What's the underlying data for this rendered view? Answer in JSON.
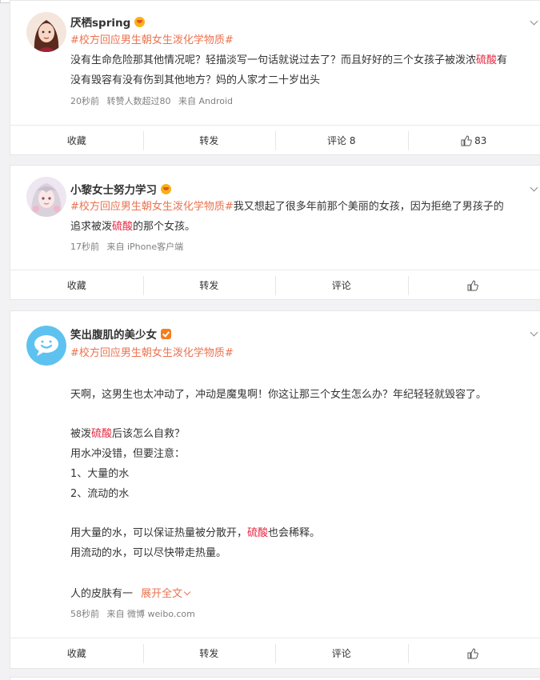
{
  "posts": [
    {
      "user": "厌栖spring",
      "badge": "crown",
      "topic": "#校方回应男生朝女生泼化学物质#",
      "line1_a": "没有生命危险那其他情况呢？轻描淡写一句话就说过去了？而且好好的三个女孩子被泼浓",
      "line1_kw": "硫酸",
      "line1_b": "有",
      "line2": "没有毁容有没有伤到其他地方？妈的人家才二十岁出头",
      "meta": {
        "time": "20秒前",
        "extra": "转赞人数超过80",
        "source": "来自 Android"
      },
      "actions": {
        "fav": "收藏",
        "repost": "转发",
        "comment": "评论 8",
        "like": "83"
      }
    },
    {
      "user": "小黎女士努力学习",
      "badge": "crown",
      "topic": "#校方回应男生朝女生泼化学物质#",
      "line1_rest": "我又想起了很多年前那个美丽的女孩，因为拒绝了男孩子的",
      "line2_a": "追求被泼",
      "line2_kw": "硫酸",
      "line2_b": "的那个女孩。",
      "meta": {
        "time": "17秒前",
        "source": "来自 iPhone客户端"
      },
      "actions": {
        "fav": "收藏",
        "repost": "转发",
        "comment": "评论",
        "like": ""
      }
    },
    {
      "user": "笑出腹肌的美少女",
      "badge": "verified",
      "topic": "#校方回应男生朝女生泼化学物质#",
      "p1": "天啊，这男生也太冲动了，冲动是魔鬼啊！你这让那三个女生怎么办？年纪轻轻就毁容了。",
      "p2_a": "被泼",
      "p2_kw": "硫酸",
      "p2_b": "后该怎么自救？",
      "p3": "用水冲没错，但要注意：",
      "p4": "1、大量的水",
      "p5": "2、流动的水",
      "p6_a": "用大量的水，可以保证热量被分散开，",
      "p6_kw": "硫酸",
      "p6_b": "也会稀释。",
      "p7": "用流动的水，可以尽快带走热量。",
      "p8": "人的皮肤有一",
      "expand": "展开全文",
      "meta": {
        "time": "58秒前",
        "source": "来自 微博 weibo.com"
      },
      "actions": {
        "fav": "收藏",
        "repost": "转发",
        "comment": "评论",
        "like": ""
      }
    }
  ],
  "colors": {
    "topic": "#eb7350",
    "keyword": "#e5243d",
    "meta": "#808080"
  }
}
